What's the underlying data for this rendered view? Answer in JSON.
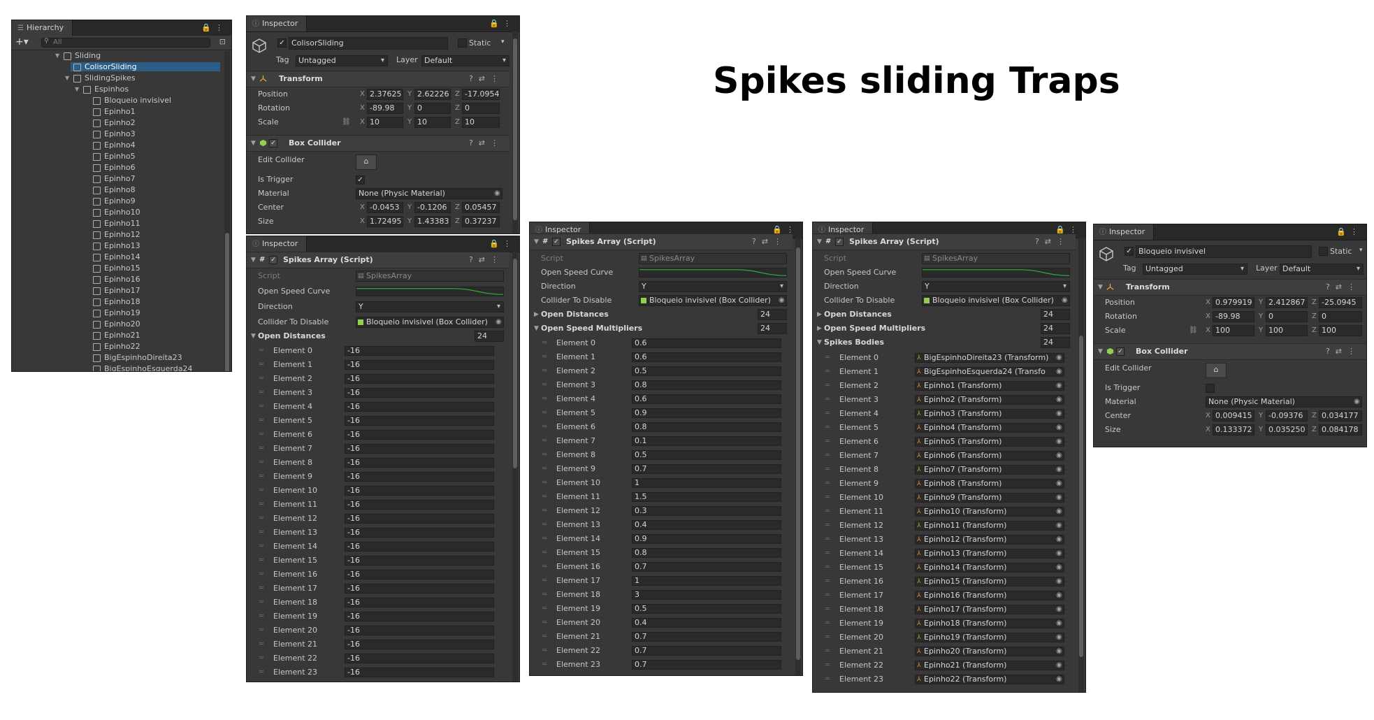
{
  "title": "Spikes sliding Traps",
  "hierarchy": {
    "tab": "Hierarchy",
    "search_placeholder": "All",
    "items": [
      {
        "label": "Sliding",
        "indent": 0,
        "arrow": true
      },
      {
        "label": "ColisorSliding",
        "indent": 1,
        "arrow": false,
        "selected": true
      },
      {
        "label": "SlidingSpikes",
        "indent": 1,
        "arrow": true
      },
      {
        "label": "Espinhos",
        "indent": 2,
        "arrow": true
      },
      {
        "label": "Bloqueio invisivel",
        "indent": 3
      },
      {
        "label": "Epinho1",
        "indent": 3
      },
      {
        "label": "Epinho2",
        "indent": 3
      },
      {
        "label": "Epinho3",
        "indent": 3
      },
      {
        "label": "Epinho4",
        "indent": 3
      },
      {
        "label": "Epinho5",
        "indent": 3
      },
      {
        "label": "Epinho6",
        "indent": 3
      },
      {
        "label": "Epinho7",
        "indent": 3
      },
      {
        "label": "Epinho8",
        "indent": 3
      },
      {
        "label": "Epinho9",
        "indent": 3
      },
      {
        "label": "Epinho10",
        "indent": 3
      },
      {
        "label": "Epinho11",
        "indent": 3
      },
      {
        "label": "Epinho12",
        "indent": 3
      },
      {
        "label": "Epinho13",
        "indent": 3
      },
      {
        "label": "Epinho14",
        "indent": 3
      },
      {
        "label": "Epinho15",
        "indent": 3
      },
      {
        "label": "Epinho16",
        "indent": 3
      },
      {
        "label": "Epinho17",
        "indent": 3
      },
      {
        "label": "Epinho18",
        "indent": 3
      },
      {
        "label": "Epinho19",
        "indent": 3
      },
      {
        "label": "Epinho20",
        "indent": 3
      },
      {
        "label": "Epinho21",
        "indent": 3
      },
      {
        "label": "Epinho22",
        "indent": 3
      },
      {
        "label": "BigEspinhoDireita23",
        "indent": 3
      },
      {
        "label": "BigEspinhoEsquerda24",
        "indent": 3
      }
    ]
  },
  "inspector1": {
    "tab": "Inspector",
    "object_name": "ColisorSliding",
    "static_label": "Static",
    "tag_label": "Tag",
    "tag_value": "Untagged",
    "layer_label": "Layer",
    "layer_value": "Default",
    "transform": {
      "title": "Transform",
      "position": {
        "label": "Position",
        "x": "2.37625",
        "y": "2.62226",
        "z": "-17.0954"
      },
      "rotation": {
        "label": "Rotation",
        "x": "-89.98",
        "y": "0",
        "z": "0"
      },
      "scale": {
        "label": "Scale",
        "x": "10",
        "y": "10",
        "z": "10"
      }
    },
    "box_collider": {
      "title": "Box Collider",
      "edit_collider": "Edit Collider",
      "is_trigger": "Is Trigger",
      "material_label": "Material",
      "material_value": "None (Physic Material)",
      "center": {
        "label": "Center",
        "x": "-0.0453",
        "y": "-0.1206",
        "z": "0.05457"
      },
      "size": {
        "label": "Size",
        "x": "1.724951",
        "y": "1.43383",
        "z": "0.37237"
      }
    }
  },
  "inspector2": {
    "tab": "Inspector",
    "component": "Spikes Array (Script)",
    "script_label": "Script",
    "script_value": "SpikesArray",
    "open_speed_curve": "Open Speed Curve",
    "direction_label": "Direction",
    "direction_value": "Y",
    "collider_label": "Collider To Disable",
    "collider_value": "Bloqueio invisivel (Box Collider)",
    "open_distances": "Open Distances",
    "count": "24",
    "elements": [
      "-16",
      "-16",
      "-16",
      "-16",
      "-16",
      "-16",
      "-16",
      "-16",
      "-16",
      "-16",
      "-16",
      "-16",
      "-16",
      "-16",
      "-16",
      "-16",
      "-16",
      "-16",
      "-16",
      "-16",
      "-16",
      "-16",
      "-16",
      "-16"
    ]
  },
  "inspector3": {
    "tab": "Inspector",
    "component": "Spikes Array (Script)",
    "script_label": "Script",
    "script_value": "SpikesArray",
    "open_speed_curve": "Open Speed Curve",
    "direction_label": "Direction",
    "direction_value": "Y",
    "collider_label": "Collider To Disable",
    "collider_value": "Bloqueio invisivel (Box Collider)",
    "open_distances": "Open Distances",
    "open_distances_count": "24",
    "multipliers": "Open Speed Multipliers",
    "multipliers_count": "24",
    "elements": [
      "0.6",
      "0.6",
      "0.5",
      "0.8",
      "0.6",
      "0.9",
      "0.8",
      "0.1",
      "0.5",
      "0.7",
      "1",
      "1.5",
      "0.3",
      "0.4",
      "0.9",
      "0.8",
      "0.7",
      "1",
      "3",
      "0.5",
      "0.4",
      "0.7",
      "0.7",
      "0.7"
    ]
  },
  "inspector4": {
    "tab": "Inspector",
    "component": "Spikes Array (Script)",
    "script_label": "Script",
    "script_value": "SpikesArray",
    "open_speed_curve": "Open Speed Curve",
    "direction_label": "Direction",
    "direction_value": "Y",
    "collider_label": "Collider To Disable",
    "collider_value": "Bloqueio invisivel (Box Collider)",
    "open_distances": "Open Distances",
    "open_distances_count": "24",
    "multipliers": "Open Speed Multipliers",
    "multipliers_count": "24",
    "bodies": "Spikes Bodies",
    "bodies_count": "24",
    "elements": [
      "BigEspinhoDireita23 (Transform)",
      "BigEspinhoEsquerda24 (Transfo",
      "Epinho1 (Transform)",
      "Epinho2 (Transform)",
      "Epinho3 (Transform)",
      "Epinho4 (Transform)",
      "Epinho5 (Transform)",
      "Epinho6 (Transform)",
      "Epinho7 (Transform)",
      "Epinho8 (Transform)",
      "Epinho9 (Transform)",
      "Epinho10 (Transform)",
      "Epinho11 (Transform)",
      "Epinho12 (Transform)",
      "Epinho13 (Transform)",
      "Epinho14 (Transform)",
      "Epinho15 (Transform)",
      "Epinho16 (Transform)",
      "Epinho17 (Transform)",
      "Epinho18 (Transform)",
      "Epinho19 (Transform)",
      "Epinho20 (Transform)",
      "Epinho21 (Transform)",
      "Epinho22 (Transform)"
    ]
  },
  "inspector5": {
    "tab": "Inspector",
    "object_name": "Bloqueio invisivel",
    "static_label": "Static",
    "tag_label": "Tag",
    "tag_value": "Untagged",
    "layer_label": "Layer",
    "layer_value": "Default",
    "transform": {
      "title": "Transform",
      "position": {
        "label": "Position",
        "x": "0.979919",
        "y": "2.412867",
        "z": "-25.0945"
      },
      "rotation": {
        "label": "Rotation",
        "x": "-89.98",
        "y": "0",
        "z": "0"
      },
      "scale": {
        "label": "Scale",
        "x": "100",
        "y": "100",
        "z": "100"
      }
    },
    "box_collider": {
      "title": "Box Collider",
      "edit_collider": "Edit Collider",
      "is_trigger": "Is Trigger",
      "material_label": "Material",
      "material_value": "None (Physic Material)",
      "center": {
        "label": "Center",
        "x": "0.009415",
        "y": "-0.09376",
        "z": "0.034177"
      },
      "size": {
        "label": "Size",
        "x": "0.133372",
        "y": "0.035250",
        "z": "0.084178"
      }
    }
  },
  "element_prefix": "Element",
  "axis": {
    "x": "X",
    "y": "Y",
    "z": "Z"
  },
  "colors": {
    "panel": "#383838",
    "field": "#2a2a2a",
    "selection": "#2c5d87",
    "curve": "#2fa838",
    "collider_icon": "#8fd14f",
    "transform_icon": "#e0a030"
  }
}
